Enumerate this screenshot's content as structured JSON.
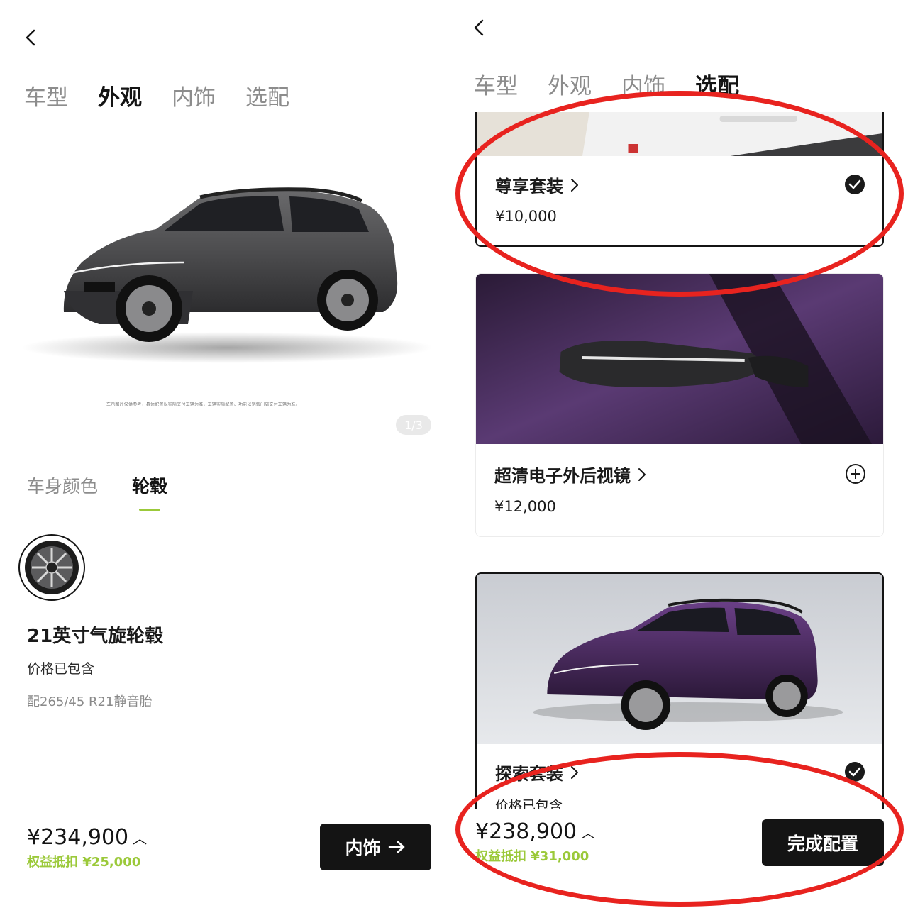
{
  "left": {
    "nav": {
      "back_icon": "chevron-left-icon"
    },
    "tabs": [
      {
        "label": "车型",
        "active": false
      },
      {
        "label": "外观",
        "active": true
      },
      {
        "label": "内饰",
        "active": false
      },
      {
        "label": "选配",
        "active": false
      }
    ],
    "hero": {
      "car_color": "#4a4a4c",
      "pager": "1/3",
      "disclaimer": "车示图片仅供参考，具体配置以实际交付车辆为准，车辆实际配置、功能以销售门店交付车辆为准。"
    },
    "subtabs": [
      {
        "label": "车身颜色",
        "active": false
      },
      {
        "label": "轮毂",
        "active": true
      }
    ],
    "wheel": {
      "icon": "wheel-rim-icon",
      "name": "21英寸气旋轮毂",
      "price_note": "价格已包含",
      "tire": "配265/45 R21静音胎"
    },
    "bottom": {
      "total": "¥234,900",
      "discount": "权益抵扣 ¥25,000",
      "next_label": "内饰",
      "next_icon": "arrow-right-icon"
    }
  },
  "right": {
    "nav": {
      "back_icon": "chevron-left-icon"
    },
    "tabs": [
      {
        "label": "车型",
        "active": false
      },
      {
        "label": "外观",
        "active": false
      },
      {
        "label": "内饰",
        "active": false
      },
      {
        "label": "选配",
        "active": true
      }
    ],
    "options": [
      {
        "title": "尊享套装",
        "price": "¥10,000",
        "selected": true,
        "state_icon": "check-circle-icon"
      },
      {
        "title": "超清电子外后视镜",
        "price": "¥12,000",
        "selected": false,
        "state_icon": "plus-circle-icon"
      },
      {
        "title": "探索套装",
        "price": "价格已包含",
        "selected": true,
        "state_icon": "check-circle-icon",
        "car_color": "#3a2250"
      }
    ],
    "bottom": {
      "total": "¥238,900",
      "discount": "权益抵扣 ¥31,000",
      "finish_label": "完成配置"
    }
  },
  "colors": {
    "accent_green": "#9bc93a",
    "annotation_red": "#e8231f",
    "dark": "#141414",
    "purple_paint": "#4b2a63"
  }
}
